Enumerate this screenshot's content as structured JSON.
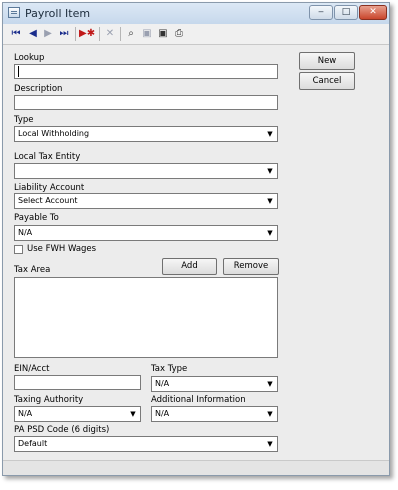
{
  "window": {
    "title": "Payroll Item",
    "controls": {
      "minimize": "‒",
      "maximize": "□",
      "close": "✕"
    }
  },
  "toolbar": {
    "buttons": [
      {
        "name": "first-record-icon",
        "glyph": "⏮"
      },
      {
        "name": "previous-record-icon",
        "glyph": "◀"
      },
      {
        "name": "next-record-icon",
        "glyph": "▶"
      },
      {
        "name": "last-record-icon",
        "glyph": "⏭"
      },
      {
        "name": "new-record-icon",
        "glyph": "▶✱"
      },
      {
        "name": "delete-icon",
        "glyph": "✕"
      },
      {
        "name": "find-icon",
        "glyph": "⌕"
      },
      {
        "name": "save-icon",
        "glyph": "▣"
      },
      {
        "name": "save-close-icon",
        "glyph": "▣"
      },
      {
        "name": "print-icon",
        "glyph": "⎙"
      }
    ]
  },
  "form": {
    "lookup": {
      "label": "Lookup",
      "value": ""
    },
    "description": {
      "label": "Description",
      "value": ""
    },
    "type": {
      "label": "Type",
      "value": "Local Withholding"
    },
    "local_tax_entity": {
      "label": "Local Tax Entity",
      "value": ""
    },
    "liability_account": {
      "label": "Liability Account",
      "value": "Select Account"
    },
    "payable_to": {
      "label": "Payable To",
      "value": "N/A"
    },
    "use_fwh_wages": {
      "label": "Use FWH Wages",
      "checked": false
    },
    "tax_area": {
      "label": "Tax Area",
      "add_label": "Add",
      "remove_label": "Remove",
      "items": []
    },
    "ein_acct": {
      "label": "EIN/Acct",
      "value": ""
    },
    "tax_type": {
      "label": "Tax Type",
      "value": "N/A"
    },
    "taxing_authority": {
      "label": "Taxing Authority",
      "value": "N/A"
    },
    "additional_information": {
      "label": "Additional Information",
      "value": "N/A"
    },
    "pa_psd_code": {
      "label": "PA PSD Code (6 digits)",
      "value": "Default"
    }
  },
  "side_buttons": {
    "new_label": "New",
    "cancel_label": "Cancel"
  },
  "dropdown_arrow": "▼"
}
